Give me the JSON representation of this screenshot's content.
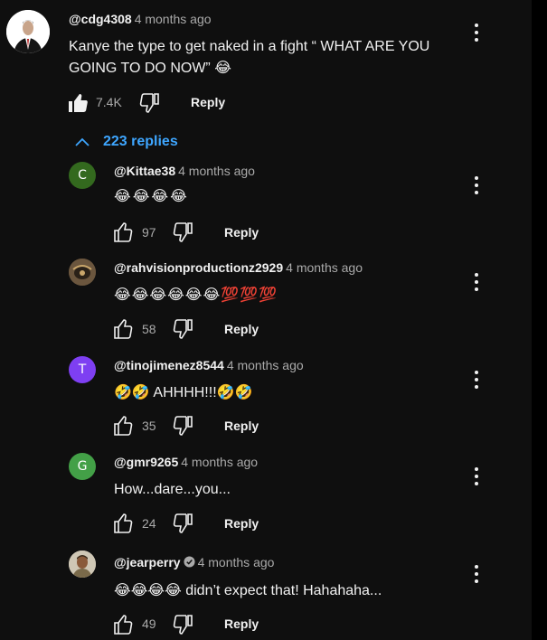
{
  "main_comment": {
    "handle": "@cdg4308",
    "time": "4 months ago",
    "text_line1": "Kanye the type to get naked in a fight “ WHAT ARE YOU",
    "text_line2": "GOING TO DO NOW” 😂",
    "likes": "7.4K",
    "reply_label": "Reply"
  },
  "replies_toggle": {
    "label": "223 replies"
  },
  "replies": [
    {
      "handle": "@Kittae38",
      "time": "4 months ago",
      "text": "😂😂😂😂",
      "likes": "97",
      "reply_label": "Reply",
      "avatar_letter": "C",
      "avatar_color": "#33691e"
    },
    {
      "handle": "@rahvisionproductionz2929",
      "time": "4 months ago",
      "text": "😂😂😂😂😂😂💯💯💯",
      "likes": "58",
      "reply_label": "Reply"
    },
    {
      "handle": "@tinojimenez8544",
      "time": "4 months ago",
      "text": "🤣🤣 AHHHH!!!🤣🤣",
      "likes": "35",
      "reply_label": "Reply",
      "avatar_letter": "T",
      "avatar_color": "#7e3ff2"
    },
    {
      "handle": "@gmr9265",
      "time": "4 months ago",
      "text": "How...dare...you...",
      "likes": "24",
      "reply_label": "Reply",
      "avatar_letter": "G",
      "avatar_color": "#43a047"
    },
    {
      "handle": "@jearperry",
      "time": "4 months ago",
      "text": "😂😂😂😂 didn’t expect that! Hahahaha...",
      "likes": "49",
      "reply_label": "Reply"
    }
  ],
  "colors": {
    "background": "#0f0f0f",
    "link": "#3ea6ff",
    "secondary_text": "#aaaaaa"
  }
}
